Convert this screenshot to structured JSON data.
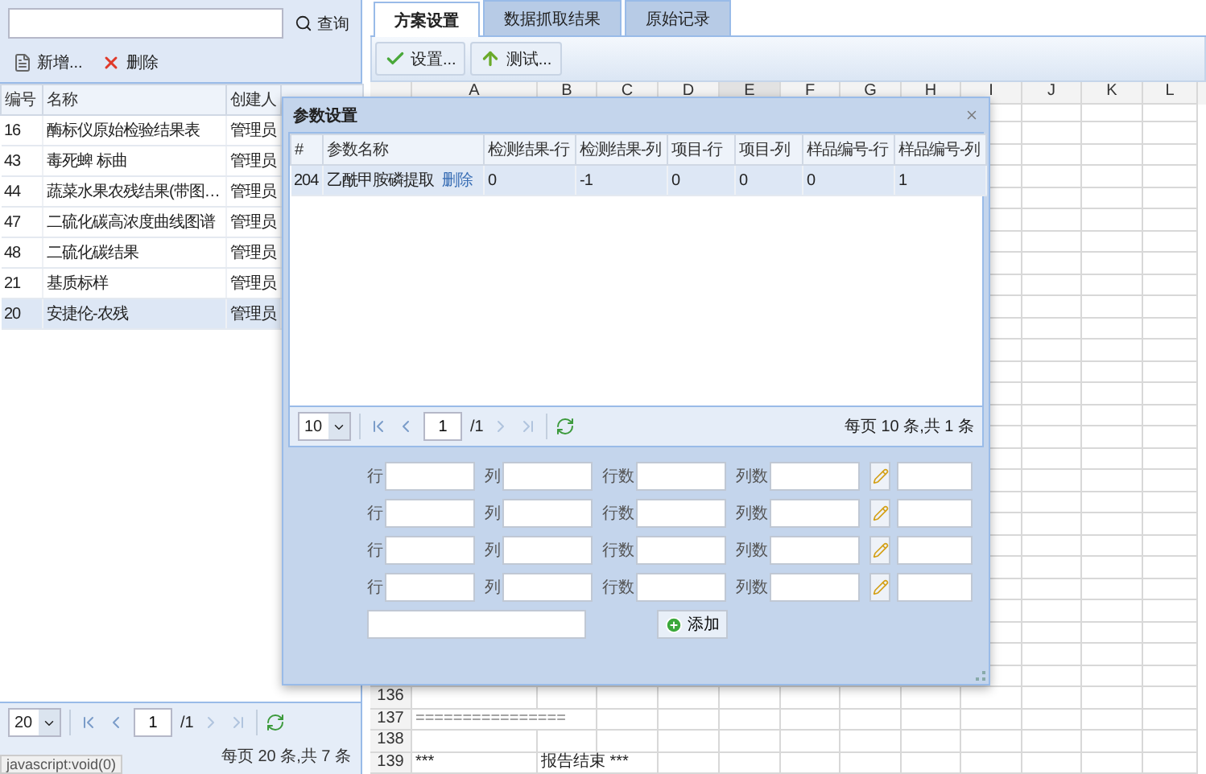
{
  "left_panel": {
    "search_button": "查询",
    "toolbar": [
      {
        "kind": "add",
        "label": "新增..."
      },
      {
        "kind": "delete",
        "label": "删除"
      }
    ],
    "table": {
      "columns": [
        "编号",
        "名称",
        "创建人"
      ],
      "rows": [
        {
          "cells": [
            "16",
            "酶标仪原始检验结果表",
            "管理员"
          ],
          "selected": false
        },
        {
          "cells": [
            "43",
            "毒死蜱 标曲",
            "管理员"
          ],
          "selected": false
        },
        {
          "cells": [
            "44",
            "蔬菜水果农残结果(带图…",
            "管理员"
          ],
          "selected": false
        },
        {
          "cells": [
            "47",
            "二硫化碳高浓度曲线图谱",
            "管理员"
          ],
          "selected": false
        },
        {
          "cells": [
            "48",
            "二硫化碳结果",
            "管理员"
          ],
          "selected": false
        },
        {
          "cells": [
            "21",
            "基质标样",
            "管理员"
          ],
          "selected": false
        },
        {
          "cells": [
            "20",
            "安捷伦-农残",
            "管理员"
          ],
          "selected": true
        }
      ]
    },
    "pager": {
      "page_size": "20",
      "page": "1",
      "total_pages": "/1",
      "summary": "每页 20 条,共 7 条"
    }
  },
  "status_tip": "javascript:void(0)",
  "tabs": [
    {
      "label": "方案设置",
      "selected": true
    },
    {
      "label": "数据抓取结果",
      "selected": false
    },
    {
      "label": "原始记录",
      "selected": false
    }
  ],
  "toolbar": [
    {
      "kind": "check",
      "label": "设置..."
    },
    {
      "kind": "up",
      "label": "测试..."
    }
  ],
  "sheet": {
    "columns": [
      {
        "label": "A",
        "selected": false
      },
      {
        "label": "B",
        "selected": false
      },
      {
        "label": "C",
        "selected": false
      },
      {
        "label": "D",
        "selected": false
      },
      {
        "label": "E",
        "selected": true
      },
      {
        "label": "F",
        "selected": false
      },
      {
        "label": "G",
        "selected": false
      },
      {
        "label": "H",
        "selected": false
      },
      {
        "label": "I",
        "selected": false
      },
      {
        "label": "J",
        "selected": false
      },
      {
        "label": "K",
        "selected": false
      },
      {
        "label": "L",
        "selected": false
      }
    ],
    "rows": [
      {
        "number": "136",
        "cells": []
      },
      {
        "number": "137",
        "cells": [
          "================"
        ]
      },
      {
        "number": "138",
        "cells": []
      },
      {
        "number": "139",
        "cells": [
          "***",
          "报告结束 ***"
        ]
      }
    ]
  },
  "dialog": {
    "title": "参数设置",
    "table": {
      "columns": [
        "#",
        "参数名称",
        "检测结果-行",
        "检测结果-列",
        "项目-行",
        "项目-列",
        "样品编号-行",
        "样品编号-列"
      ],
      "rows": [
        {
          "cells": [
            "204",
            "乙酰甲胺磷提取",
            "0",
            "-1",
            "0",
            "0",
            "0",
            "1"
          ],
          "action": "删除",
          "selected": true
        }
      ]
    },
    "pager": {
      "page_size": "10",
      "page": "1",
      "total_pages": "/1",
      "summary": "每页 10 条,共 1 条"
    },
    "form_rows": [
      {
        "labels": [
          "行",
          "列",
          "行数",
          "列数"
        ]
      },
      {
        "labels": [
          "行",
          "列",
          "行数",
          "列数"
        ]
      },
      {
        "labels": [
          "行",
          "列",
          "行数",
          "列数"
        ]
      },
      {
        "labels": [
          "行",
          "列",
          "行数",
          "列数"
        ]
      }
    ],
    "add_button": "添加"
  }
}
